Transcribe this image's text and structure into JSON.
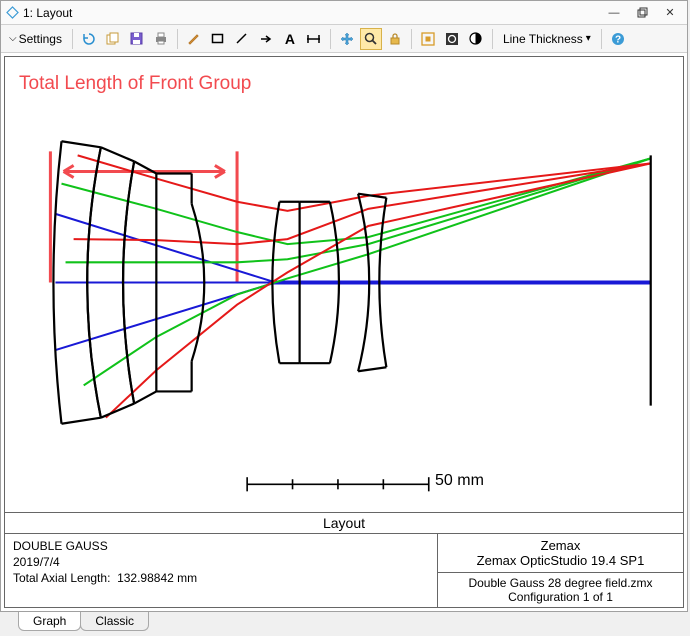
{
  "window": {
    "title": "1: Layout"
  },
  "toolbar": {
    "settings_label": "Settings",
    "line_thickness_label": "Line Thickness"
  },
  "annotation": {
    "label": "Total Length of Front Group"
  },
  "scale": {
    "label": "50 mm"
  },
  "plot": {
    "caption": "Layout"
  },
  "info": {
    "title": "DOUBLE GAUSS",
    "date": "2019/7/4",
    "axial_length_label": "Total Axial Length:",
    "axial_length_value": "132.98842 mm",
    "vendor": "Zemax",
    "product": "Zemax OpticStudio 19.4 SP1",
    "file": "Double Gauss 28 degree field.zmx",
    "config": "Configuration 1 of 1"
  },
  "tabs": {
    "graph": "Graph",
    "classic": "Classic"
  }
}
